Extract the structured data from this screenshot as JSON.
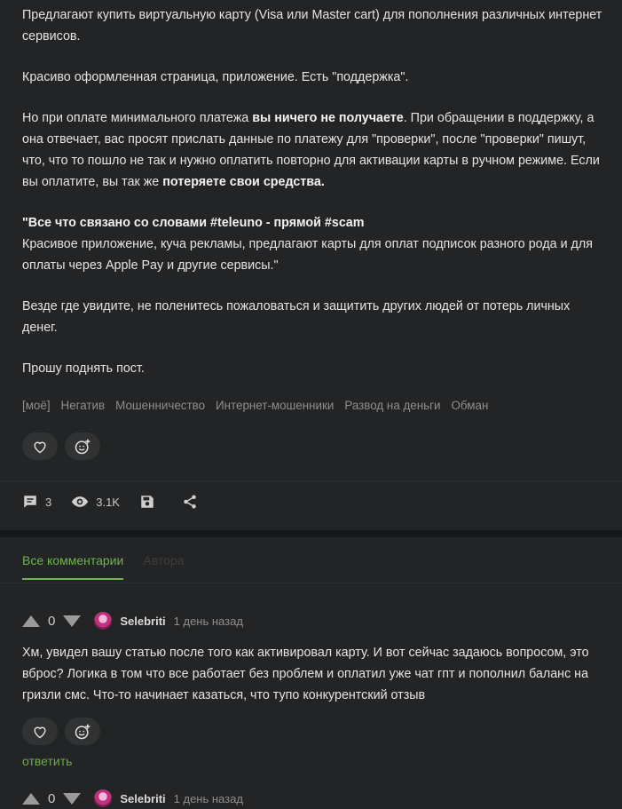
{
  "post": {
    "p1": "Предлагают купить виртуальную карту (Visa или Master cart) для пополнения различных интернет сервисов.",
    "p2": "Красиво оформленная страница, приложение. Есть \"поддержка\".",
    "p3_a": "Но при оплате минимального платежа ",
    "p3_b": "вы ничего не получаете",
    "p3_c": ". При обращении в поддержку, а она отвечает, вас просят прислать данные по платежу для \"проверки\", после \"проверки\" пишут, что, что то пошло не так и нужно оплатить повторно для активации карты в ручном режиме. Если вы оплатите, вы так же ",
    "p3_d": "потеряете свои средства.",
    "p4_a": "\"Все что связано со словами #teleuno - прямой #scam",
    "p4_b": "Красивое приложение, куча рекламы, предлагают карты для оплат подписок разного рода и для оплаты через Apple Pay и другие сервисы.\"",
    "p5": "Везде где увидите, не поленитесь пожаловаться и защитить других людей от потерь личных денег.",
    "p6": "Прошу поднять пост."
  },
  "tags": [
    "[моё]",
    "Негатив",
    "Мошенничество",
    "Интернет-мошенники",
    "Развод на деньги",
    "Обман"
  ],
  "stats": {
    "comments": "3",
    "views": "3.1K"
  },
  "tabs": {
    "all": "Все комментарии",
    "author": "Автора"
  },
  "comments": [
    {
      "rating": "0",
      "author": "Selebriti",
      "time": "1 день назад",
      "text": "Хм, увидел вашу статью после того как активировал карту. И вот сейчас задаюсь вопросом, это вброс? Логика в том что все работает без проблем и оплатил уже чат гпт и пополнил баланс на гризли смс. Что-то начинает казаться, что тупо конкурентский отзыв",
      "reply": "ответить"
    },
    {
      "rating": "0",
      "author": "Selebriti",
      "time": "1 день назад"
    }
  ],
  "colors": {
    "accent": "#6fb44d",
    "background": "#161718",
    "card": "#232425"
  },
  "icons": [
    "heart-icon",
    "emoji-add-icon",
    "comment-icon",
    "eye-icon",
    "save-icon",
    "share-icon",
    "upvote-icon",
    "downvote-icon"
  ]
}
